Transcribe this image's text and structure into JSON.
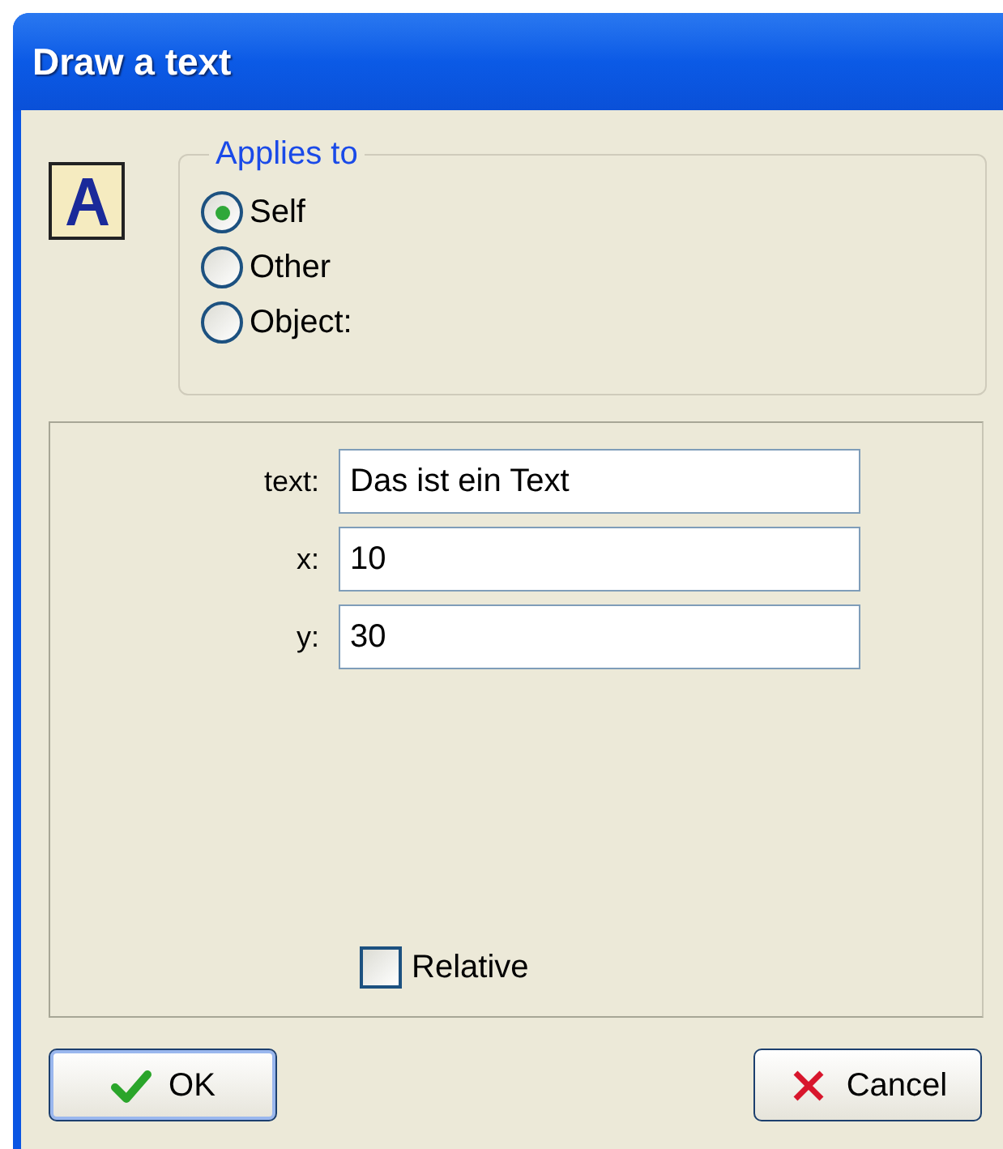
{
  "window": {
    "title": "Draw a text"
  },
  "applies_to": {
    "label": "Applies to",
    "options": [
      {
        "label": "Self",
        "selected": true
      },
      {
        "label": "Other",
        "selected": false
      },
      {
        "label": "Object:",
        "selected": false
      }
    ]
  },
  "fields": [
    {
      "label": "text:",
      "value": "Das ist ein Text"
    },
    {
      "label": "x:",
      "value": "10"
    },
    {
      "label": "y:",
      "value": "30"
    }
  ],
  "relative": {
    "label": "Relative",
    "checked": false
  },
  "buttons": [
    {
      "kind": "ok",
      "label": "OK",
      "focused": true
    },
    {
      "kind": "cancel",
      "label": "Cancel",
      "focused": false
    }
  ]
}
